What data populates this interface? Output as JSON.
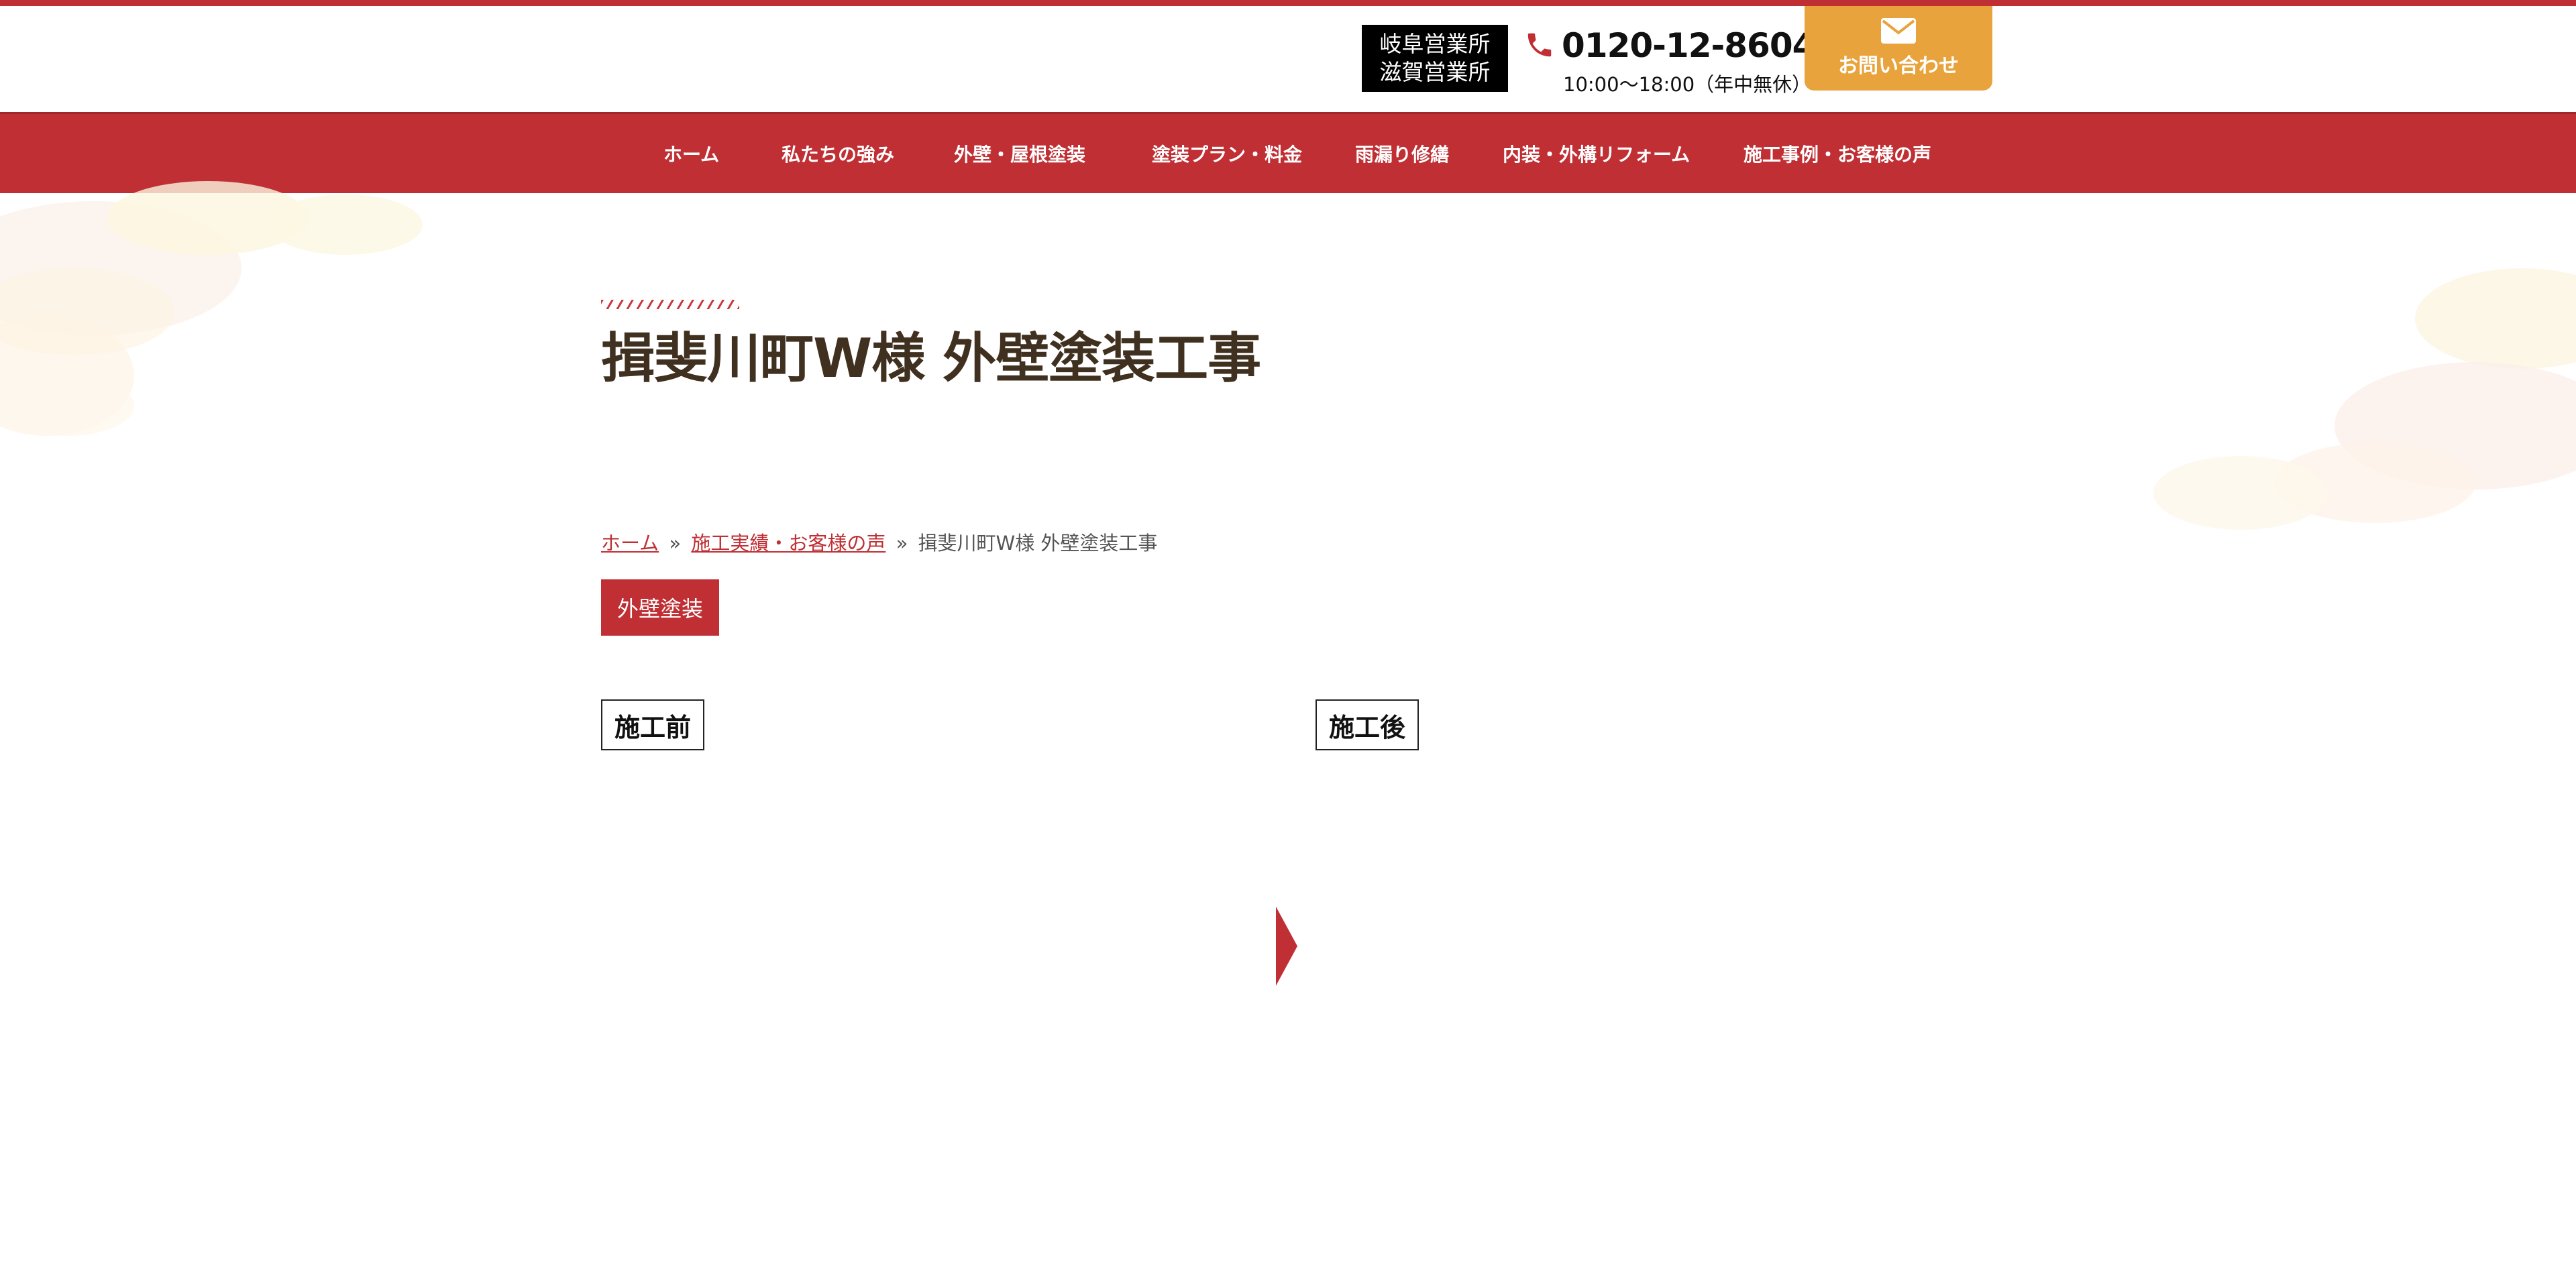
{
  "header": {
    "offices": [
      "岐阜営業所",
      "滋賀営業所"
    ],
    "phone_number": "0120-12-8604",
    "phone_hours": "10:00〜18:00（年中無休）",
    "contact_label": "お問い合わせ",
    "icons": {
      "phone": "phone-icon",
      "contact": "mail-icon"
    }
  },
  "nav": {
    "items": [
      {
        "label": "ホーム"
      },
      {
        "label": "私たちの強み"
      },
      {
        "label": "外壁・屋根塗装"
      },
      {
        "label": "塗装プラン・料金"
      },
      {
        "label": "雨漏り修繕"
      },
      {
        "label": "内装・外構リフォーム"
      },
      {
        "label": "施工事例・お客様の声"
      }
    ]
  },
  "main": {
    "title": "揖斐川町W様 外壁塗装工事",
    "breadcrumb": {
      "home": "ホーム",
      "separator": "»",
      "section": "施工実績・お客様の声",
      "current": "揖斐川町W様 外壁塗装工事"
    },
    "category": "外壁塗装",
    "before_label": "施工前",
    "after_label": "施工後",
    "arrow_icon": "arrow-right-icon"
  },
  "colors": {
    "brand_red": "#bf2f34",
    "accent_orange": "#e8a33c",
    "title_brown": "#40301f",
    "badge_black": "#000000"
  }
}
